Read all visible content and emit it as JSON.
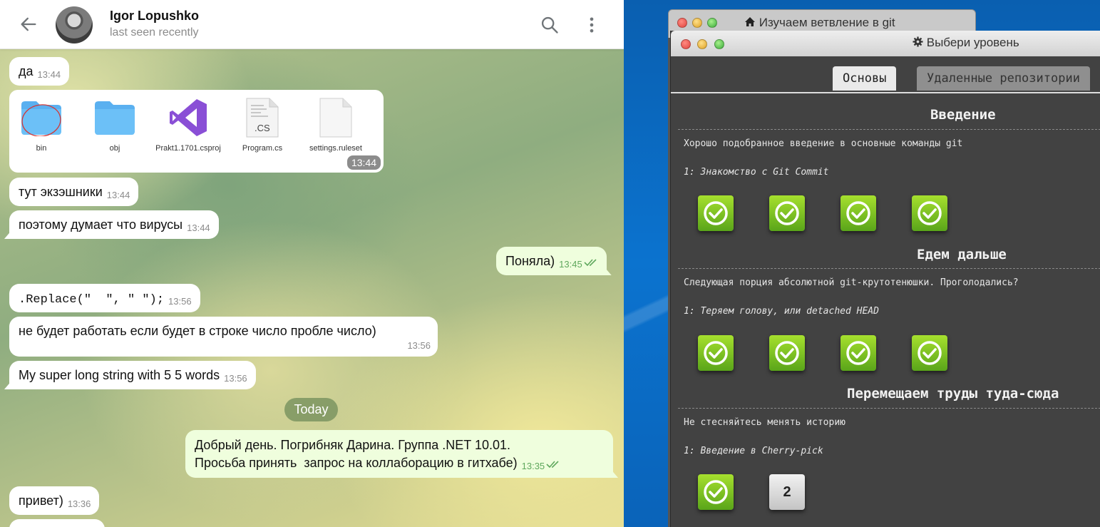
{
  "telegram": {
    "peer_name": "Igor Lopushko",
    "peer_status": "last seen recently",
    "messages": [
      {
        "text": "да",
        "time": "13:44"
      },
      {
        "text": "тут экзэшники",
        "time": "13:44"
      },
      {
        "text": "поэтому думает что вирусы",
        "time": "13:44"
      },
      {
        "text": "Поняла)",
        "time": "13:45"
      },
      {
        "text": ".Replace(\"  \", \" \");",
        "time": "13:56"
      },
      {
        "text": "не будет работать если будет в строке число пробле число)",
        "time": "13:56"
      },
      {
        "text": "My super long string with 5 5 words",
        "time": "13:56"
      },
      {
        "text_line1": "Добрый день. Погрибняк Дарина. Группа .NET 10.01.",
        "text_line2": "Просьба принять  запрос на коллаборацию в гитхабе)",
        "time": "13:35"
      },
      {
        "text": "привет)",
        "time": "13:36"
      }
    ],
    "files": {
      "items": [
        {
          "name": "bin",
          "icon": "folder-icon"
        },
        {
          "name": "obj",
          "icon": "folder-icon"
        },
        {
          "name": "Prakt1.1701.csproj",
          "icon": "visual-studio-icon"
        },
        {
          "name": "Program.cs",
          "icon": "cs-file-icon"
        },
        {
          "name": "settings.ruleset",
          "icon": "blank-file-icon"
        }
      ],
      "time": "13:44"
    },
    "date_chip": "Today"
  },
  "git_app": {
    "back_window_title": "Изучаем ветвление в git",
    "front_window_title": "Выбери уровень",
    "tabs": [
      "Основы",
      "Удаленные репозитории"
    ],
    "sections": [
      {
        "title": "Введение",
        "about": "Хорошо подобранное введение в основные команды git",
        "level_name": "1: Знакомство с Git Commit",
        "levels": [
          "done",
          "done",
          "done",
          "done"
        ]
      },
      {
        "title": "Едем дальше",
        "about": "Следующая порция абсолютной git-крутотенюшки. Проголодались?",
        "level_name": "1: Теряем голову, или detached HEAD",
        "levels": [
          "done",
          "done",
          "done",
          "done"
        ]
      },
      {
        "title": "Перемещаем труды туда-сюда",
        "about": "Не стесняйтесь менять историю",
        "level_name": "1: Введение в Cherry-pick",
        "levels": [
          "done",
          "2"
        ]
      }
    ]
  },
  "colors": {
    "outgoing_bubble": "#effedd",
    "incoming_bubble": "#ffffff",
    "level_done_green": "#7cc423",
    "app_bg": "#424242"
  }
}
